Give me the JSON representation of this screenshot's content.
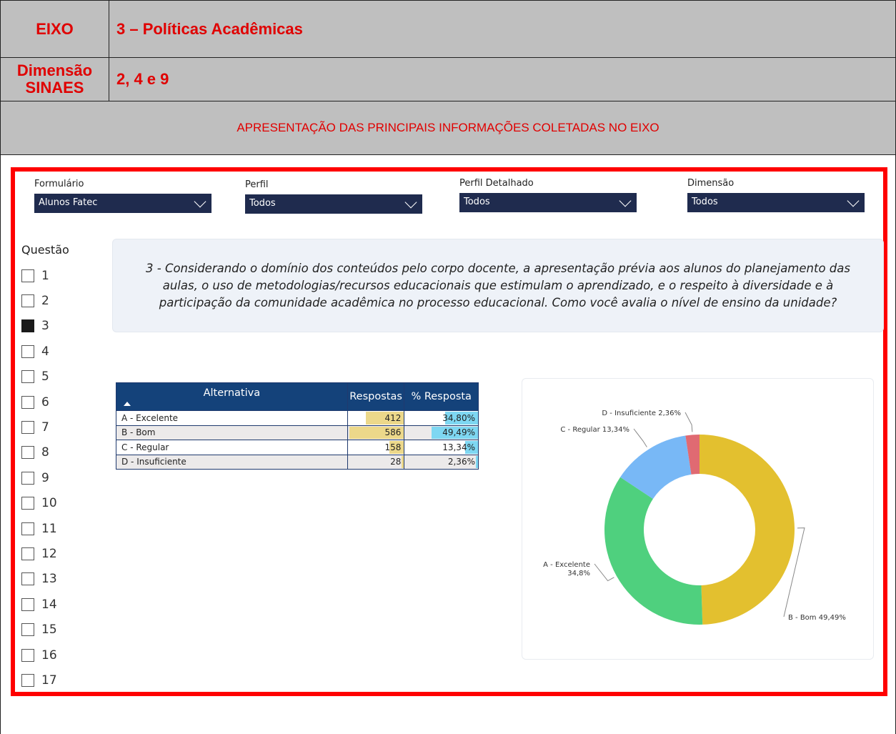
{
  "header": {
    "eixo_label": "EIXO",
    "eixo_value": "3 – Políticas Acadêmicas",
    "dimensao_label_1": "Dimensão",
    "dimensao_label_2": "SINAES",
    "dimensao_value": "2, 4 e 9",
    "section_title": "APRESENTAÇÃO DAS PRINCIPAIS INFORMAÇÕES COLETADAS NO EIXO"
  },
  "filters": [
    {
      "label": "Formulário",
      "value": "Alunos Fatec"
    },
    {
      "label": "Perfil",
      "value": "Todos"
    },
    {
      "label": "Perfil Detalhado",
      "value": "Todos"
    },
    {
      "label": "Dimensão",
      "value": "Todos"
    }
  ],
  "questions": {
    "title": "Questão",
    "items": [
      "1",
      "2",
      "3",
      "4",
      "5",
      "6",
      "7",
      "8",
      "9",
      "10",
      "11",
      "12",
      "13",
      "14",
      "15",
      "16",
      "17"
    ],
    "selected": "3"
  },
  "question_text": "3 - Considerando o domínio dos conteúdos pelo corpo docente, a apresentação prévia aos alunos do planejamento das aulas, o uso de metodologias/recursos educacionais que estimulam o aprendizado, e o respeito à diversidade e à participação da comunidade acadêmica no processo educacional. Como você avalia o nível de ensino da unidade?",
  "table": {
    "headers": [
      "Alternativa",
      "Respostas",
      "% Resposta"
    ],
    "rows": [
      {
        "alt": "A - Excelente",
        "resp": "412",
        "pct": "34,80%"
      },
      {
        "alt": "B - Bom",
        "resp": "586",
        "pct": "49,49%"
      },
      {
        "alt": "C - Regular",
        "resp": "158",
        "pct": "13,34%"
      },
      {
        "alt": "D - Insuficiente",
        "resp": "28",
        "pct": "2,36%"
      }
    ]
  },
  "colors": {
    "bom": "#e3c02f",
    "excelente": "#4fd07e",
    "regular": "#78b8f6",
    "insuficiente": "#e06a72"
  },
  "chart_data": {
    "type": "pie",
    "variant": "donut",
    "categories": [
      "B - Bom",
      "A - Excelente",
      "C - Regular",
      "D - Insuficiente"
    ],
    "values": [
      49.49,
      34.8,
      13.34,
      2.36
    ],
    "labels": [
      "B - Bom 49,49%",
      "A - Excelente 34,8%",
      "C - Regular 13,34%",
      "D - Insuficiente 2,36%"
    ]
  }
}
